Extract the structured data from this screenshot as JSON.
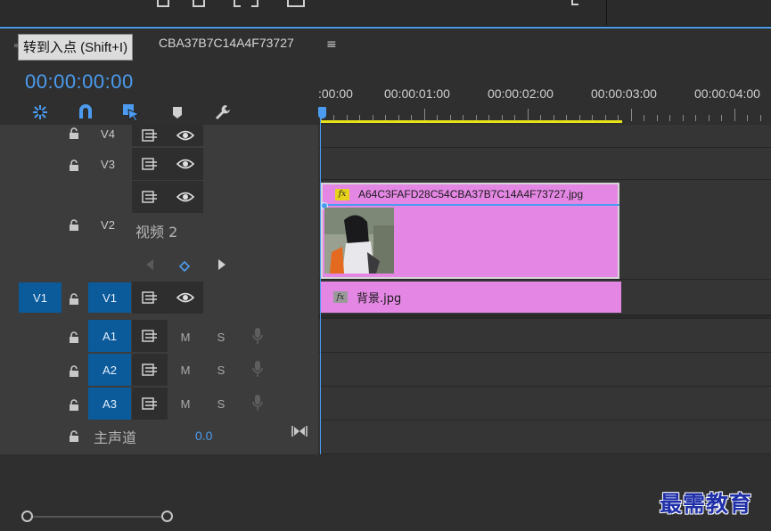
{
  "sequence_tab": {
    "name": "CBA37B7C14A4F73727",
    "menu_glyph": "≡"
  },
  "tooltip": {
    "text": "转到入点 (Shift+I)"
  },
  "timecode": "00:00:00:00",
  "ruler": {
    "labels": [
      ":00:00",
      "00:00:01:00",
      "00:00:02:00",
      "00:00:03:00",
      "00:00:04:00"
    ]
  },
  "tracks": {
    "v4": {
      "label": "V4"
    },
    "v3": {
      "label": "V3"
    },
    "v2": {
      "label": "V2",
      "name": "视频 2"
    },
    "v1": {
      "source": "V1",
      "label": "V1"
    },
    "a1": {
      "label": "A1",
      "mute": "M",
      "solo": "S"
    },
    "a2": {
      "label": "A2",
      "mute": "M",
      "solo": "S"
    },
    "a3": {
      "label": "A3",
      "mute": "M",
      "solo": "S"
    },
    "master": {
      "label": "主声道",
      "value": "0.0"
    }
  },
  "clips": {
    "v2_clip": {
      "name": "A64C3FAFD28C54CBA37B7C14A4F73727.jpg",
      "fx": "fx"
    },
    "v1_clip": {
      "name": "背景.jpg",
      "fx": "fx"
    }
  },
  "colors": {
    "accent": "#4b9cf0",
    "clip": "#e487e4",
    "track_target": "#0b5a9a",
    "work_area": "#e8e21a"
  },
  "watermark": {
    "text": "最需教育"
  }
}
